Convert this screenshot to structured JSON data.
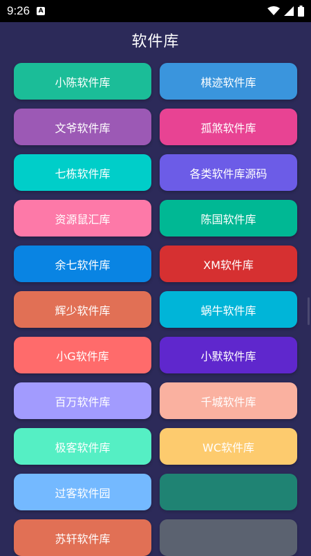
{
  "status_bar": {
    "time": "9:26",
    "notification_icon": "a-icon"
  },
  "header": {
    "title": "软件库"
  },
  "colors": {
    "background": "#2c2a59"
  },
  "buttons": [
    {
      "label": "小陈软件库",
      "color": "#1bbd98"
    },
    {
      "label": "棋迹软件库",
      "color": "#3a95dd"
    },
    {
      "label": "文爷软件库",
      "color": "#9c59b5"
    },
    {
      "label": "孤煞软件库",
      "color": "#e84393"
    },
    {
      "label": "七栋软件库",
      "color": "#00cec9"
    },
    {
      "label": "各类软件库源码",
      "color": "#6c5ce7"
    },
    {
      "label": "资源鼠汇库",
      "color": "#fd79a8"
    },
    {
      "label": "陈国软件库",
      "color": "#00b894"
    },
    {
      "label": "余七软件库",
      "color": "#0984e3"
    },
    {
      "label": "XM软件库",
      "color": "#d63031"
    },
    {
      "label": "辉少软件库",
      "color": "#e17055"
    },
    {
      "label": "蜗牛软件库",
      "color": "#00b5d8"
    },
    {
      "label": "小G软件库",
      "color": "#ff6b6b"
    },
    {
      "label": "小默软件库",
      "color": "#5f27cd"
    },
    {
      "label": "百万软件库",
      "color": "#a29bfe"
    },
    {
      "label": "千城软件库",
      "color": "#fab1a0"
    },
    {
      "label": "极客软件库",
      "color": "#55efc4"
    },
    {
      "label": "WC软件库",
      "color": "#fdcb6e"
    },
    {
      "label": "过客软件园",
      "color": "#74b9ff"
    },
    {
      "label": "",
      "color": "#1aa97f"
    },
    {
      "label": "苏轩软件库",
      "color": "#e17055"
    },
    {
      "label": "",
      "color": "#6f7a7a"
    }
  ]
}
